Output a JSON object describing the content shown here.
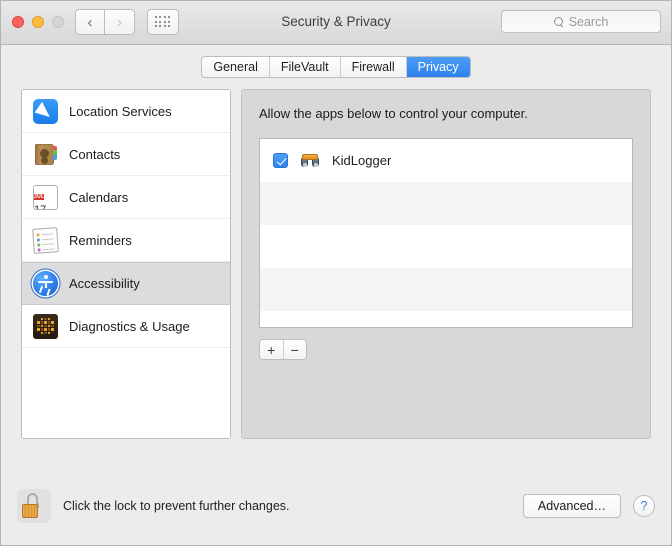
{
  "window": {
    "title": "Security & Privacy",
    "traffic_lights": [
      "close",
      "minimize",
      "zoom"
    ],
    "back_label": "‹",
    "forward_label": "›"
  },
  "search": {
    "placeholder": "Search",
    "value": ""
  },
  "tabs": [
    {
      "label": "General",
      "active": false
    },
    {
      "label": "FileVault",
      "active": false
    },
    {
      "label": "Firewall",
      "active": false
    },
    {
      "label": "Privacy",
      "active": true
    }
  ],
  "sidebar": {
    "items": [
      {
        "label": "Location Services",
        "icon": "location-services-icon",
        "selected": false
      },
      {
        "label": "Contacts",
        "icon": "contacts-icon",
        "selected": false
      },
      {
        "label": "Calendars",
        "icon": "calendars-icon",
        "selected": false
      },
      {
        "label": "Reminders",
        "icon": "reminders-icon",
        "selected": false
      },
      {
        "label": "Accessibility",
        "icon": "accessibility-icon",
        "selected": true
      },
      {
        "label": "Diagnostics & Usage",
        "icon": "diagnostics-icon",
        "selected": false
      }
    ]
  },
  "calendar_icon": {
    "month": "JUL",
    "day": "17"
  },
  "main": {
    "description": "Allow the apps below to control your computer.",
    "apps": [
      {
        "name": "KidLogger",
        "checked": true,
        "icon": "binoculars-icon"
      }
    ],
    "add_label": "+",
    "remove_label": "−"
  },
  "footer": {
    "lock_icon": "unlocked-padlock-icon",
    "lock_message": "Click the lock to prevent further changes.",
    "advanced_label": "Advanced…",
    "help_label": "?"
  },
  "colors": {
    "accent_blue": "#2f82ef",
    "window_bg": "#ececec",
    "pane_bg": "#d8d8d8",
    "selected_row": "#dcdcdc"
  }
}
